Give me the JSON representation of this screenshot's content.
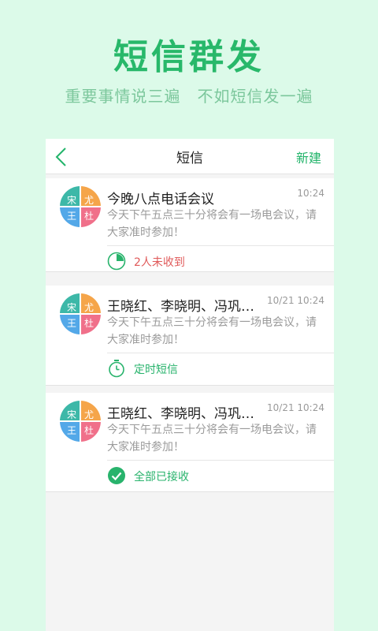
{
  "hero": {
    "title": "短信群发",
    "subtitle": "重要事情说三遍　不如短信发一遍"
  },
  "nav": {
    "back_icon": "chevron-left-icon",
    "title": "短信",
    "new_label": "新建"
  },
  "avatar_names": [
    "宋",
    "尤",
    "王",
    "杜"
  ],
  "messages": [
    {
      "title": "今晚八点电话会议",
      "time": "10:24",
      "body": "今天下午五点三十分将会有一场电会议，请大家准时参加！",
      "status_icon": "pie-progress-icon",
      "status_text": "2人未收到",
      "status_color": "#e05a5a"
    },
    {
      "title": "王晓红、李晓明、冯巩…",
      "time": "10/21 10:24",
      "body": "今天下午五点三十分将会有一场电会议，请大家准时参加！",
      "status_icon": "stopwatch-icon",
      "status_text": "定时短信",
      "status_color": "#28b36c"
    },
    {
      "title": "王晓红、李晓明、冯巩…",
      "time": "10/21 10:24",
      "body": "今天下午五点三十分将会有一场电会议，请大家准时参加！",
      "status_icon": "check-circle-icon",
      "status_text": "全部已接收",
      "status_color": "#28b36c"
    }
  ],
  "colors": {
    "accent": "#22b46a",
    "avatar_teal": "#3db8a8",
    "avatar_orange": "#f5a54a",
    "avatar_blue": "#53a8e8",
    "avatar_pink": "#f0708a"
  }
}
